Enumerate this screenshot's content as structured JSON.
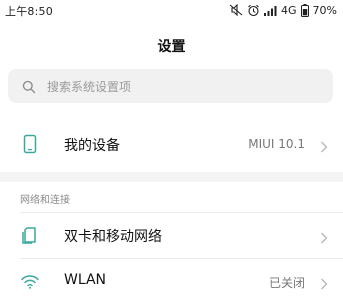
{
  "status_bar": {
    "time": "上午8:50",
    "network": "4G",
    "battery": "70%",
    "icons": [
      "mute-icon",
      "alarm-icon",
      "signal-icon",
      "battery-icon"
    ]
  },
  "header": {
    "title": "设置"
  },
  "search": {
    "placeholder": "搜索系统设置项"
  },
  "device_row": {
    "label": "我的设备",
    "value": "MIUI 10.1",
    "icon": "phone-icon"
  },
  "network_section": {
    "header": "网络和连接",
    "items": [
      {
        "label": "双卡和移动网络",
        "value": "",
        "icon": "sim-card-icon"
      },
      {
        "label": "WLAN",
        "value": "已关闭",
        "icon": "wifi-icon"
      }
    ]
  },
  "colors": {
    "accent": "#3aa89a",
    "section_background": "#f4f4f4",
    "search_background": "#f1f1f1"
  }
}
